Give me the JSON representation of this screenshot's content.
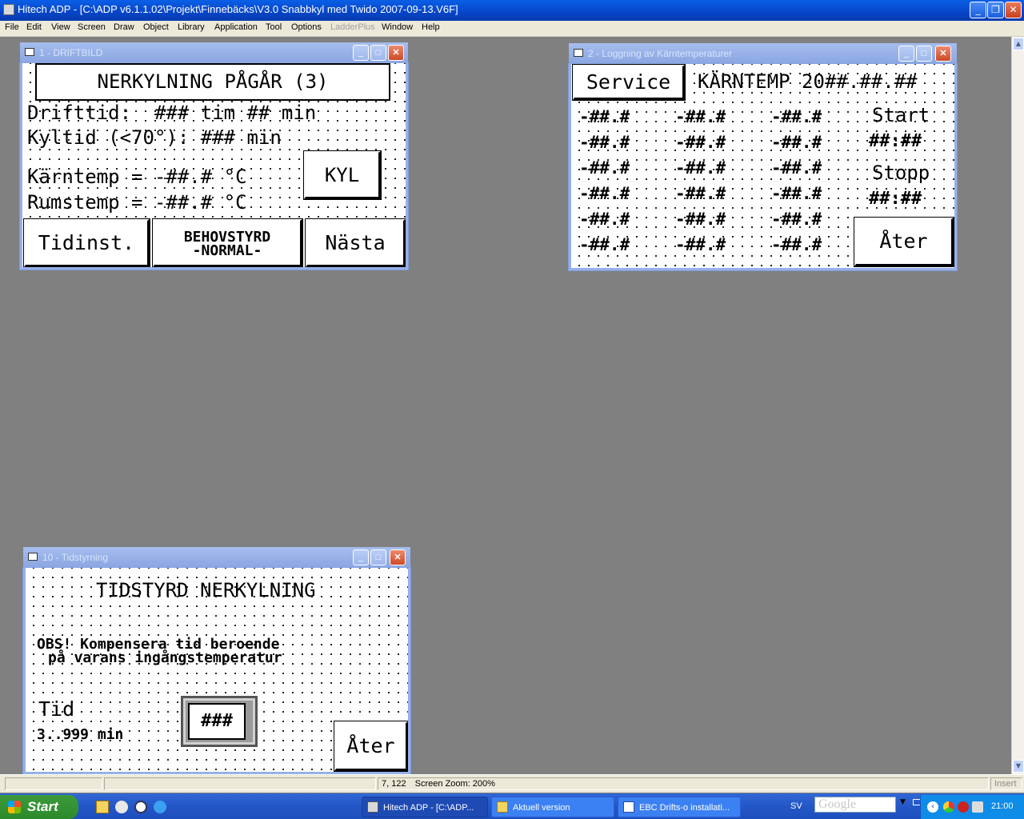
{
  "app": {
    "title": "Hitech ADP - [C:\\ADP v6.1.1.02\\Projekt\\Finnebäcks\\V3.0 Snabbkyl med Twido 2007-09-13.V6F]",
    "min_glyph": "_",
    "restore_glyph": "❐",
    "close_glyph": "✕"
  },
  "menu": {
    "items": [
      "File",
      "Edit",
      "View",
      "Screen",
      "Draw",
      "Object",
      "Library",
      "Application",
      "Tool",
      "Options",
      "LadderPlus",
      "Window",
      "Help"
    ]
  },
  "child_buttons": {
    "min": "_",
    "max": "□",
    "close": "✕"
  },
  "win1": {
    "title": "1 - DRIFTBILD",
    "header": "NERKYLNING PÅGÅR (3)",
    "drifttid": "Drifttid:  ### tim ## min",
    "kyltid": "Kyltid (<70°): ### min",
    "karntemp": "Kärntemp = -##.# °C",
    "rumstemp": "Rumstemp = -##.# °C",
    "kyl_button": "KYL",
    "tidinst_button": "Tidinst.",
    "behov_line1": "BEHOVSTYRD",
    "behov_line2": "-NORMAL-",
    "nasta_button": "Nästa"
  },
  "win2": {
    "title": "2 - Loggning av Kärntemperaturer",
    "service_button": "Service",
    "header": "KÄRNTEMP 20##.##.##",
    "log_values": [
      [
        "-##.#",
        "-##.#",
        "-##.#"
      ],
      [
        "-##.#",
        "-##.#",
        "-##.#"
      ],
      [
        "-##.#",
        "-##.#",
        "-##.#"
      ],
      [
        "-##.#",
        "-##.#",
        "-##.#"
      ],
      [
        "-##.#",
        "-##.#",
        "-##.#"
      ],
      [
        "-##.#",
        "-##.#",
        "-##.#"
      ]
    ],
    "start_label": "Start",
    "start_time": "##:##",
    "stopp_label": "Stopp",
    "stopp_time": "##:##",
    "ater_button": "Åter"
  },
  "win10": {
    "title": "10 - Tidstyrning",
    "header": "TIDSTYRD NERKYLNING",
    "obs_line1": "OBS! Kompensera tid beroende",
    "obs_line2": "på varans ingångstemperatur",
    "tid_label": "Tid",
    "tid_range": "3..999 min",
    "tid_value": "###",
    "ater_button": "Åter"
  },
  "status": {
    "coords": "7, 122",
    "zoom": "Screen Zoom: 200%",
    "insert": "Insert"
  },
  "taskbar": {
    "start": "Start",
    "tasks": [
      "Hitech ADP - [C:\\ADP...",
      "Aktuell version",
      "EBC Drifts-o installati..."
    ],
    "lang": "SV",
    "search": "Google",
    "clock": "21:00"
  }
}
